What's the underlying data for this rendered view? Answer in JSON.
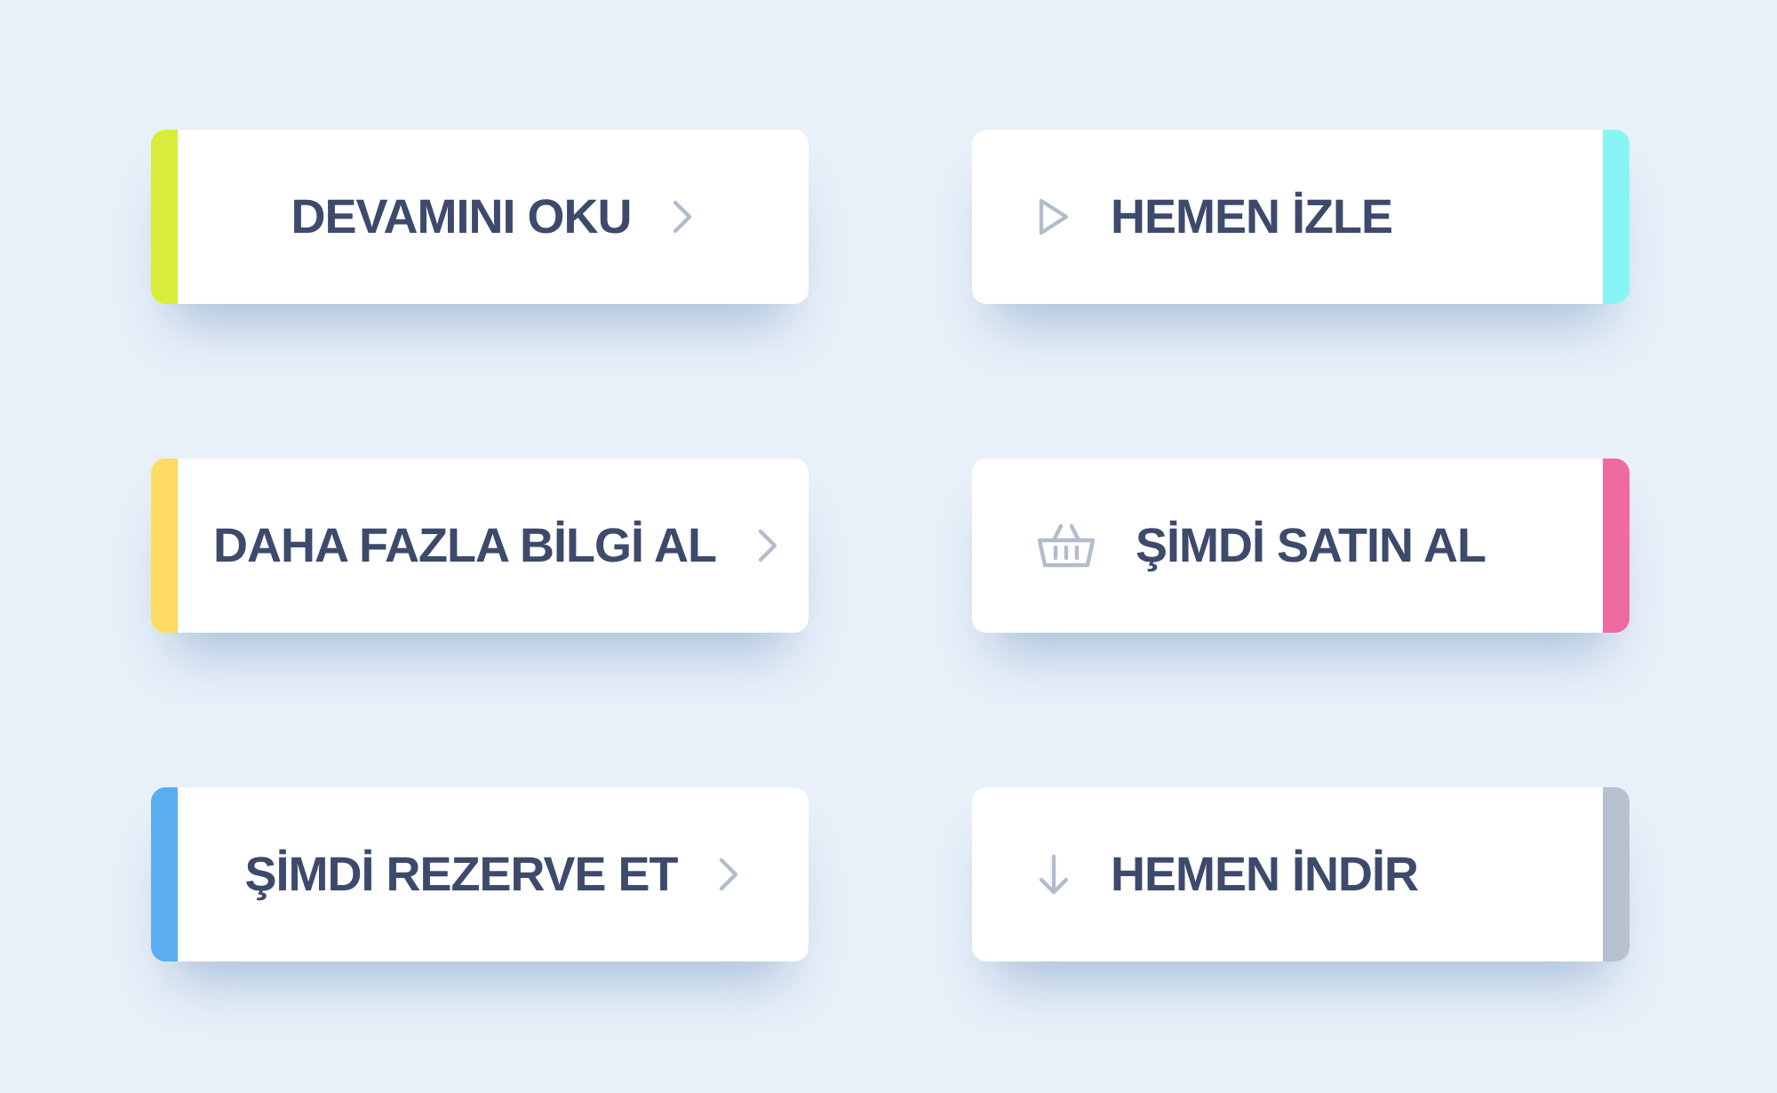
{
  "buttons": [
    {
      "label": "DEVAMINI OKU",
      "kind": "chevron",
      "color": "#d9ec3b"
    },
    {
      "label": "HEMEN İZLE",
      "kind": "play",
      "color": "#88f5f5"
    },
    {
      "label": "DAHA FAZLA BİLGİ AL",
      "kind": "chevron",
      "color": "#fedb62"
    },
    {
      "label": "ŞİMDİ SATIN AL",
      "kind": "basket",
      "color": "#ef6a9e"
    },
    {
      "label": "ŞİMDİ REZERVE ET",
      "kind": "chevron",
      "color": "#5aaef0"
    },
    {
      "label": "HEMEN İNDİR",
      "kind": "download",
      "color": "#b8c2cf"
    }
  ]
}
